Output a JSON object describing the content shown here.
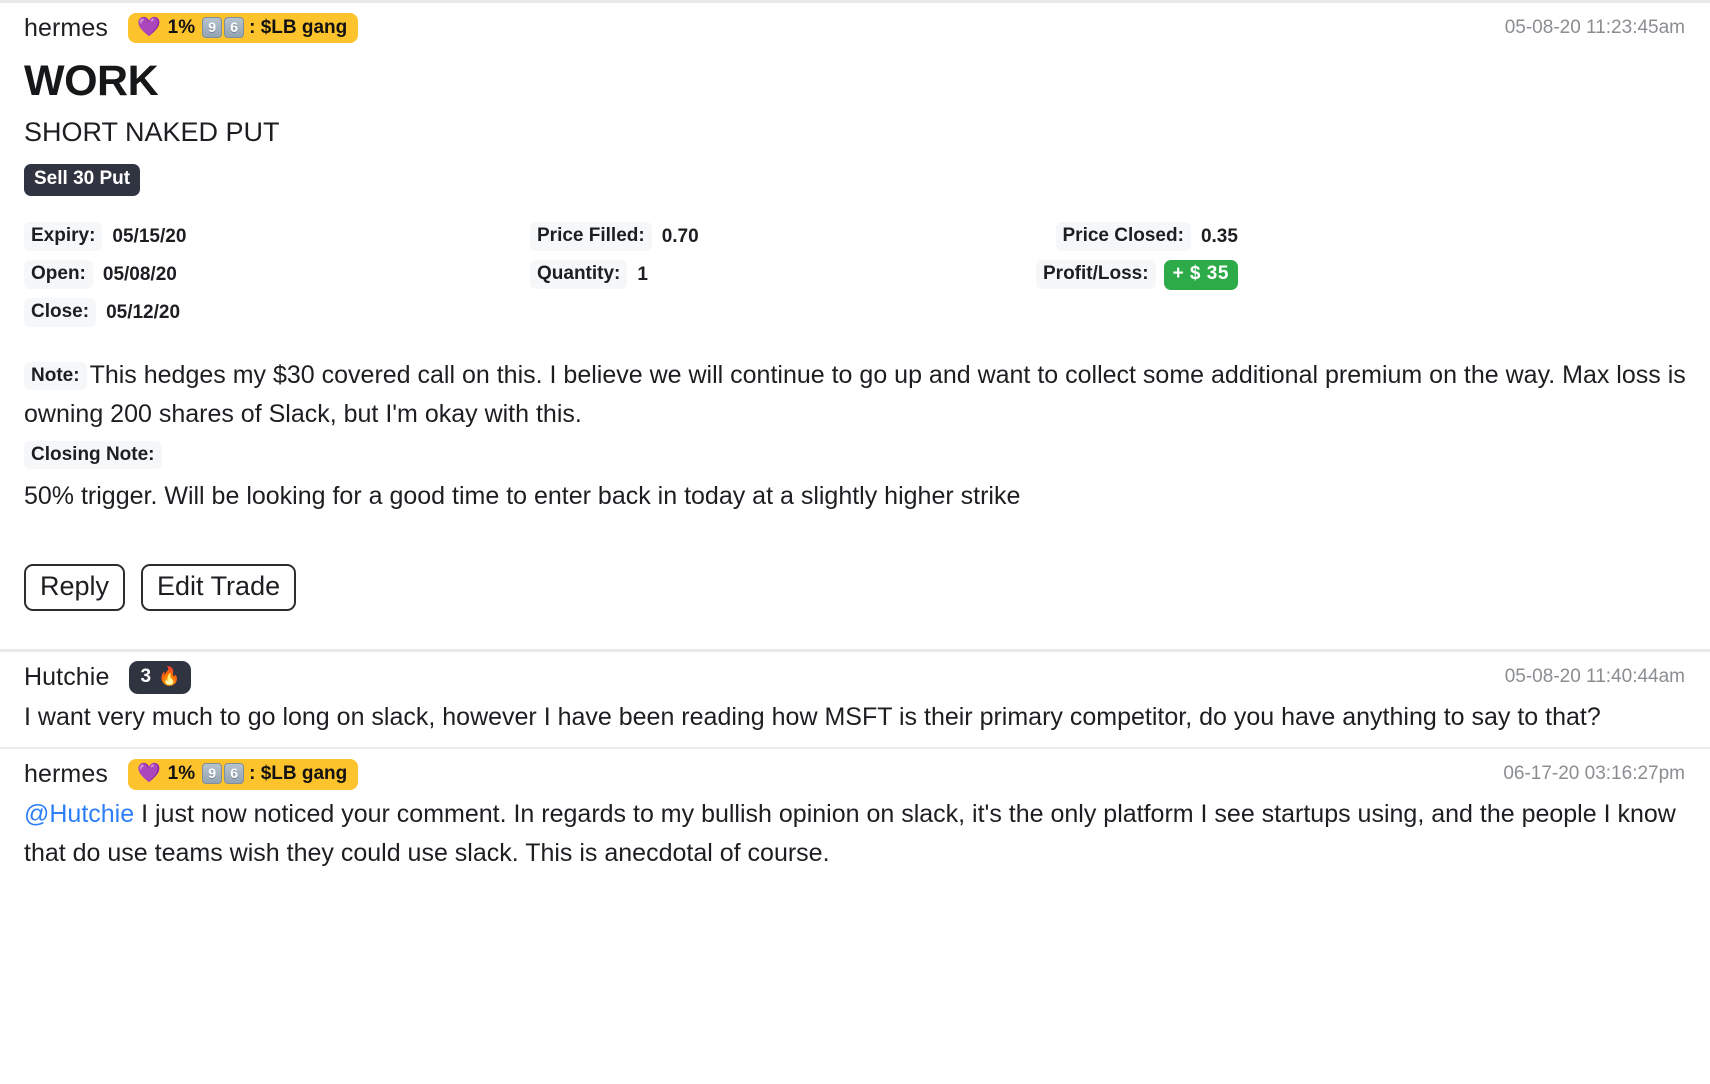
{
  "thread": {
    "post": {
      "author": "hermes",
      "badge": {
        "heart_icon": "purple-heart-icon",
        "percent": "1%",
        "keycap_1": "9",
        "keycap_2": "6",
        "suffix": ": $LB gang"
      },
      "timestamp": "05-08-20 11:23:45am",
      "ticker": "WORK",
      "strategy": "SHORT NAKED PUT",
      "leg": "Sell 30 Put",
      "details": {
        "col1": [
          {
            "label": "Expiry:",
            "value": "05/15/20"
          },
          {
            "label": "Open:",
            "value": "05/08/20"
          },
          {
            "label": "Close:",
            "value": "05/12/20"
          }
        ],
        "col2": [
          {
            "label": "Price Filled:",
            "value": "0.70"
          },
          {
            "label": "Quantity:",
            "value": "1"
          }
        ],
        "col3": [
          {
            "label": "Price Closed:",
            "value": "0.35"
          },
          {
            "label": "Profit/Loss:",
            "value": "+ $ 35",
            "badge": true,
            "badge_color": "#2eab49"
          }
        ]
      },
      "note_label": "Note:",
      "note_text": "This hedges my $30 covered call on this. I believe we will continue to go up and want to collect some additional premium on the way. Max loss is owning 200 shares of Slack, but I'm okay with this.",
      "closing_note_label": "Closing Note:",
      "closing_note_text": "50% trigger. Will be looking for a good time to enter back in today at a slightly higher strike",
      "actions": {
        "reply": "Reply",
        "edit_trade": "Edit Trade"
      }
    },
    "comments": [
      {
        "author": "Hutchie",
        "badge_count": "3",
        "badge_emoji": "fire-icon",
        "timestamp": "05-08-20 11:40:44am",
        "text": "I want very much to go long on slack, however I have been reading how MSFT is their primary competitor, do you have anything to say to that?"
      },
      {
        "author": "hermes",
        "badge": {
          "heart_icon": "purple-heart-icon",
          "percent": "1%",
          "keycap_1": "9",
          "keycap_2": "6",
          "suffix": ": $LB gang"
        },
        "timestamp": "06-17-20 03:16:27pm",
        "mention": "@Hutchie",
        "text": " I just now noticed your comment. In regards to my bullish opinion on slack, it's the only platform I see startups using, and the people I know that do use teams wish they could use slack. This is anecdotal of course."
      }
    ]
  },
  "colors": {
    "badge_gold": "#fdc32c",
    "badge_dark": "#303441",
    "profit_green": "#2eab49",
    "mention_blue": "#2d7ff9",
    "timestamp_gray": "#8a8d91"
  }
}
